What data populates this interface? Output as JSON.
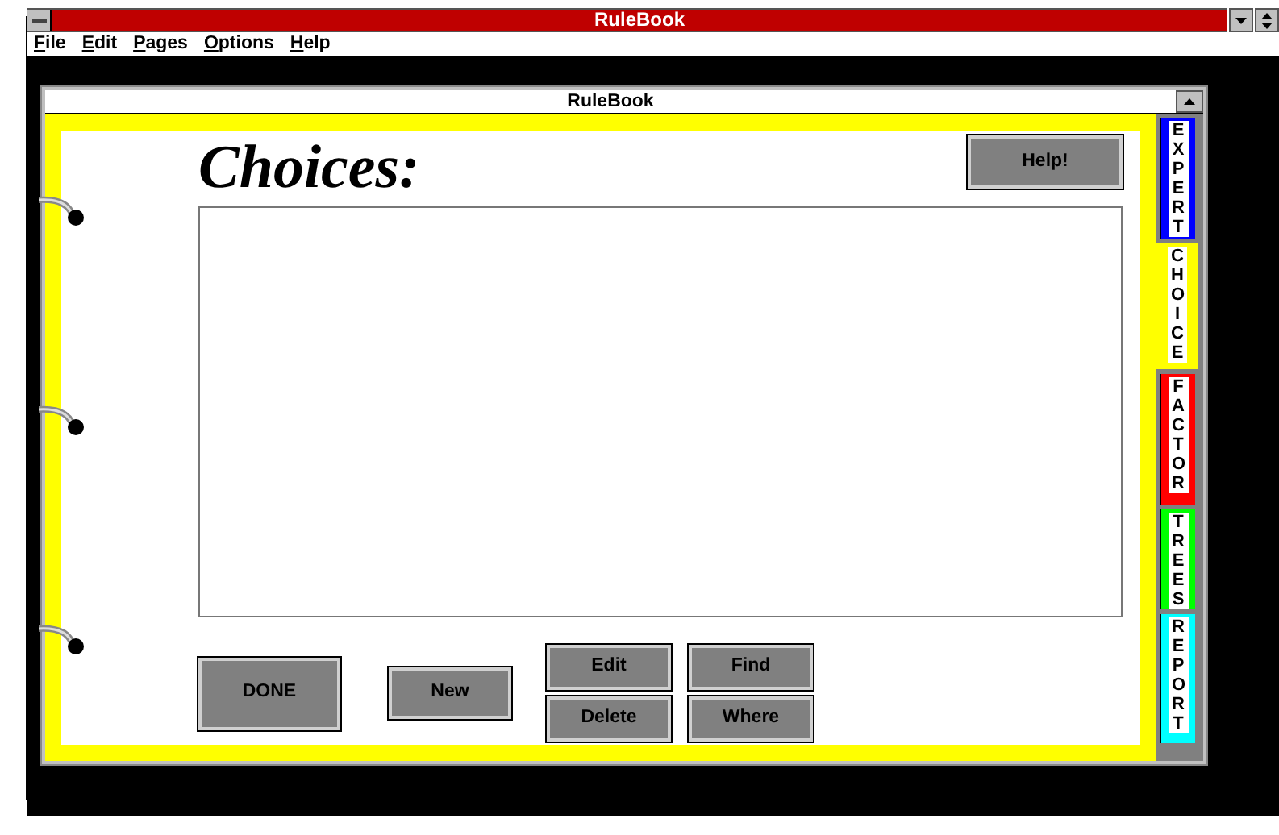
{
  "app_window": {
    "title": "RuleBook",
    "menu": [
      "File",
      "Edit",
      "Pages",
      "Options",
      "Help"
    ]
  },
  "document_window": {
    "title": "RuleBook"
  },
  "page": {
    "heading": "Choices:",
    "help_button": "Help!",
    "buttons": [
      {
        "label": "DONE",
        "kind": "large"
      },
      {
        "label": "New",
        "kind": "medium"
      },
      {
        "label": "Edit",
        "kind": "small"
      },
      {
        "label": "Find",
        "kind": "small"
      },
      {
        "label": "Delete",
        "kind": "small"
      },
      {
        "label": "Where",
        "kind": "small"
      }
    ]
  },
  "tabs": [
    {
      "label": "EXPERT",
      "color": "#0000ff",
      "selected": false
    },
    {
      "label": "CHOICE",
      "color": "#ffff00",
      "selected": true
    },
    {
      "label": "FACTOR",
      "color": "#ff0000",
      "selected": false
    },
    {
      "label": "TREES",
      "color": "#00ff00",
      "selected": false
    },
    {
      "label": "REPORT",
      "color": "#00ffff",
      "selected": false
    }
  ]
}
